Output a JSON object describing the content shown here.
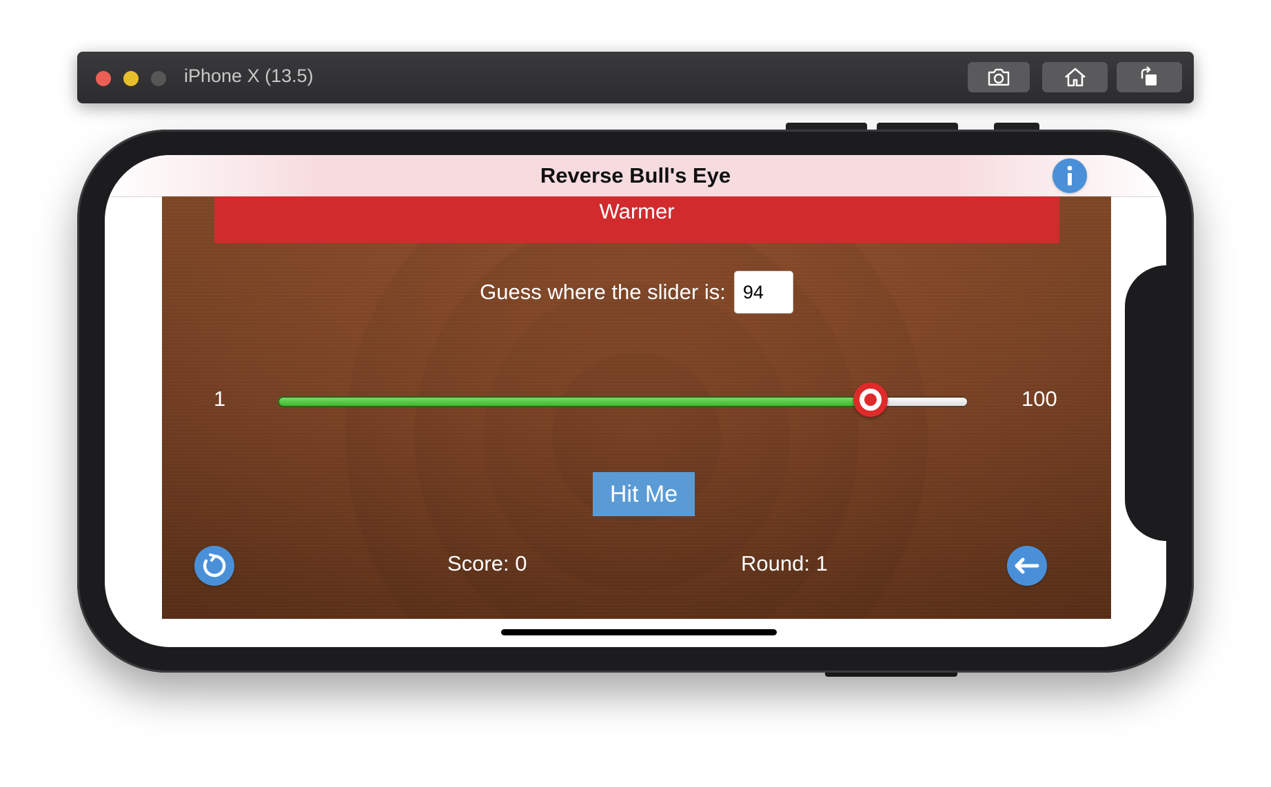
{
  "window": {
    "title": "iPhone X (13.5)",
    "toolbar": {
      "screenshot_icon": "camera-icon",
      "home_icon": "home-icon",
      "rotate_icon": "rotate-icon"
    }
  },
  "app": {
    "nav_title": "Reverse Bull's Eye",
    "info_icon": "info-icon",
    "status_banner": "Warmer",
    "guess": {
      "label": "Guess where the slider is:",
      "value": "94"
    },
    "slider": {
      "min_label": "1",
      "max_label": "100",
      "min": 1,
      "max": 100,
      "value": 86
    },
    "hit_button": "Hit Me",
    "score_text": "Score: 0",
    "round_text": "Round: 1",
    "restart_icon": "restart-icon",
    "back_icon": "back-arrow-icon"
  },
  "colors": {
    "banner": "#d22b2e",
    "accent_blue": "#4a90d9",
    "button_blue": "#5b9bd5",
    "slider_fill": "#35b024",
    "thumb": "#e02a2a"
  }
}
